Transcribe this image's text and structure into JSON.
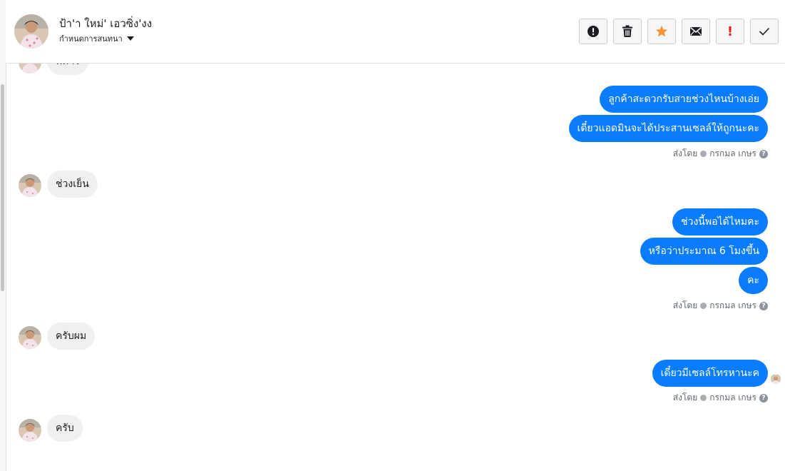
{
  "header": {
    "contact_name": "ป้า'า ใหม่' เอวซิ่ง'งง",
    "assign_label": "กำหนดการสนทนา",
    "tools": [
      {
        "icon": "alert-circle-icon"
      },
      {
        "icon": "trash-icon"
      },
      {
        "icon": "star-icon",
        "color": "#f7923b"
      },
      {
        "icon": "mail-icon"
      },
      {
        "icon": "exclamation-icon",
        "text": "!",
        "color": "#e02020"
      },
      {
        "icon": "check-icon"
      }
    ]
  },
  "messages": {
    "cut_top_text": "พี่ค่าร",
    "out_1": [
      "ลูกค้าสะดวกรับสายช่วงไหนบ้างเอ่ย",
      "เดี๋ยวแอดมินจะได้ประสานเซลล์ให้ถูกนะคะ"
    ],
    "in_1": "ช่วงเย็น",
    "out_2": [
      "ช่วงนี้พอได้ไหมคะ",
      "หรือว่าประมาณ 6 โมงขึ้น",
      "คะ"
    ],
    "in_2": "ครับผม",
    "out_3": [
      "เดี๋ยวมีเซลล์โทรหานะค"
    ],
    "in_3": "ครับ"
  },
  "sent_by": {
    "prefix": "ส่งโดย",
    "agent": "กรกมล เกษร",
    "help": "?"
  },
  "colors": {
    "outgoing_bubble": "#0a7cff",
    "incoming_bubble": "#f1f0f0"
  }
}
